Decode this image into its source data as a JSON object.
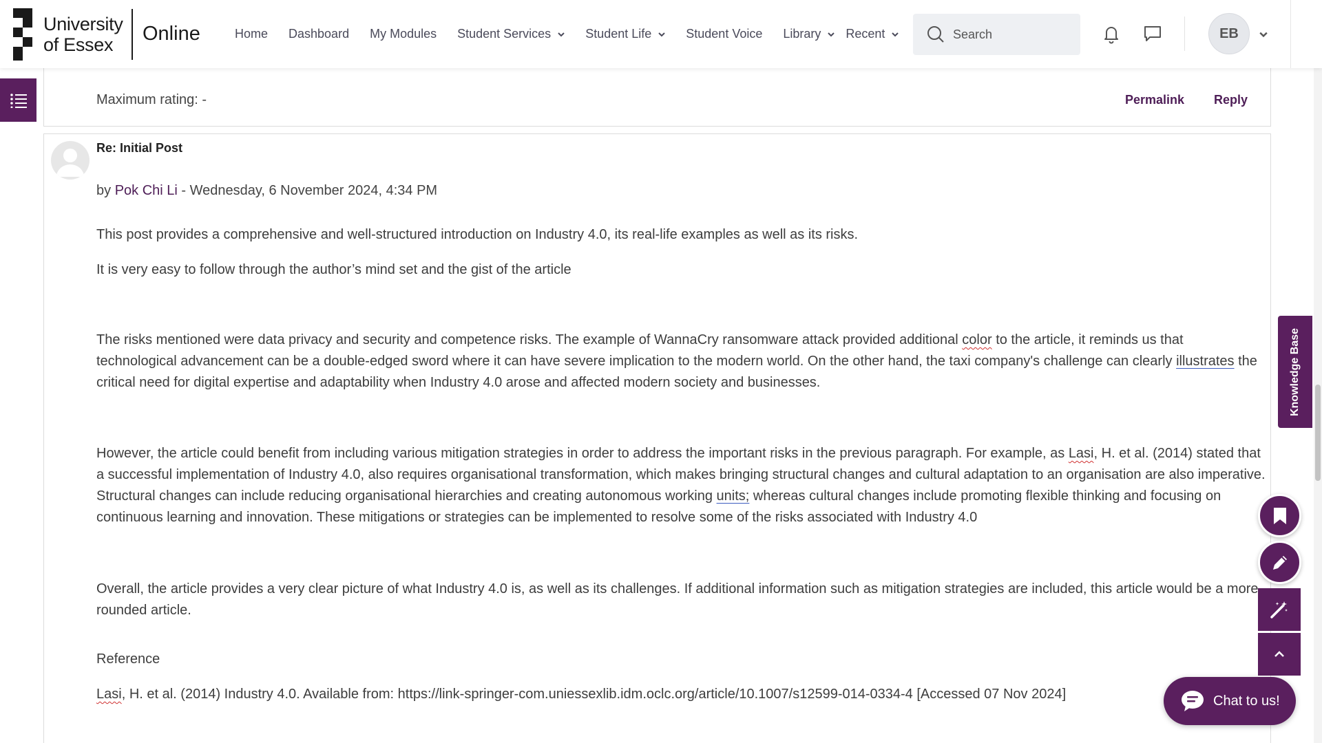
{
  "brand": {
    "line1": "University",
    "line2": "of Essex",
    "product": "Online"
  },
  "nav": [
    {
      "label": "Home",
      "dropdown": false
    },
    {
      "label": "Dashboard",
      "dropdown": false
    },
    {
      "label": "My Modules",
      "dropdown": false
    },
    {
      "label": "Student Services",
      "dropdown": true
    },
    {
      "label": "Student Life",
      "dropdown": true
    },
    {
      "label": "Student Voice",
      "dropdown": false
    },
    {
      "label": "Library",
      "dropdown": true
    },
    {
      "label": "Recent",
      "dropdown": true
    }
  ],
  "search": {
    "placeholder": "Search"
  },
  "user": {
    "initials": "EB"
  },
  "previous_post": {
    "max_rating": "Maximum rating: -",
    "permalink": "Permalink",
    "reply": "Reply"
  },
  "post": {
    "title": "Re: Initial Post",
    "by": "by ",
    "author": "Pok Chi Li",
    "date": " - Wednesday, 6 November 2024, 4:34 PM",
    "p1": "This post provides a comprehensive and well-structured introduction on Industry 4.0, its real-life examples as well as its risks.",
    "p2": "It is very easy to follow through the author’s mind set and the gist of the article",
    "p3a": "The risks mentioned were data privacy and security and competence risks. The example of WannaCry ransomware attack provided additional ",
    "p3_color": "color",
    "p3b": " to the article, it reminds us that technological advancement can be a double-edged sword where it can have severe implication to the modern world. On the other hand, the taxi company's challenge can clearly ",
    "p3_illustrates": "illustrates",
    "p3c": " the critical need for digital expertise and adaptability when Industry 4.0 arose and affected modern society and businesses.",
    "p4a": "However, the article could benefit from including various mitigation strategies in order to address the important risks in the previous paragraph. For example, as ",
    "p4_lasi": "Lasi",
    "p4b": ", H. et al. (2014) stated that a successful implementation of Industry 4.0, also requires organisational transformation, which makes bringing structural changes and cultural adaptation to an organisation are also imperative. Structural changes can include reducing organisational hierarchies and creating autonomous working ",
    "p4_units": "units;",
    "p4c": " whereas cultural changes include promoting flexible thinking and focusing on continuous learning and innovation. These mitigations or strategies can be implemented to resolve some of the risks associated with Industry 4.0",
    "p5": "Overall, the article provides a very clear picture of what Industry 4.0 is, as well as its challenges. If additional information such as mitigation strategies are included, this article would be a more rounded article.",
    "ref_heading": "Reference",
    "ref_lasi": "Lasi",
    "ref_rest": ", H. et al. (2014) Industry 4.0. Available from: https://link-springer-com.uniessexlib.idm.oclc.org/article/10.1007/s12599-014-0334-4 [Accessed 07 Nov 2024]"
  },
  "side": {
    "knowledge_base": "Knowledge Base",
    "chat": "Chat to us!"
  },
  "colors": {
    "brand_purple": "#5a1f5e",
    "link_purple": "#4e1e57"
  },
  "icons": [
    "search-icon",
    "bell-icon",
    "message-icon",
    "chevron-down-icon",
    "list-icon",
    "bookmark-icon",
    "pencil-icon",
    "magic-wand-icon",
    "chevron-up-icon",
    "chat-bubble-icon"
  ]
}
